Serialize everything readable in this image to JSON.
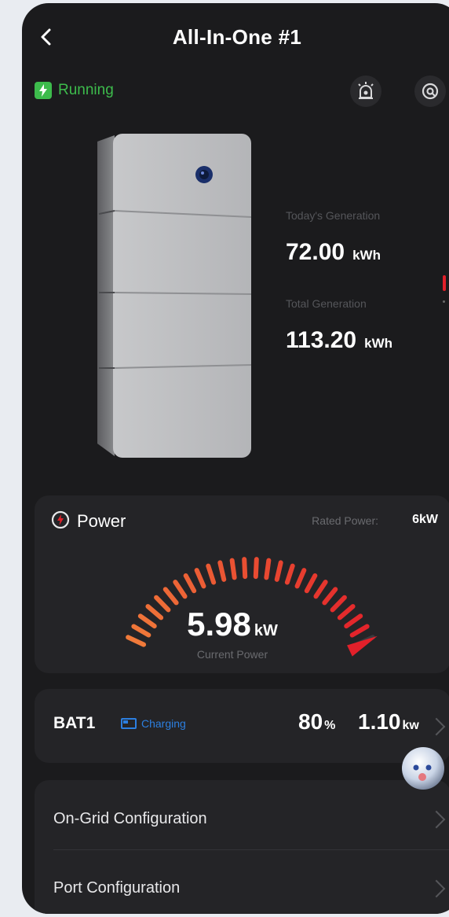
{
  "header": {
    "title": "All-In-One #1",
    "back_icon": "chevron-left-icon"
  },
  "status": {
    "label": "Running",
    "color": "#3dbb4c",
    "icon": "lightning-icon"
  },
  "toolbar": {
    "alarm_icon": "alarm-icon",
    "settings_icon": "settings-icon"
  },
  "generation": {
    "today_label": "Today's Generation",
    "today_value": "72.00",
    "today_unit": "kWh",
    "total_label": "Total Generation",
    "total_value": "113.20",
    "total_unit": "kWh"
  },
  "power": {
    "title": "Power",
    "rated_label": "Rated Power:",
    "rated_value": "6kW",
    "current_value": "5.98",
    "current_unit": "kW",
    "current_caption": "Current Power",
    "gauge_fraction": 0.9967
  },
  "battery": {
    "name": "BAT1",
    "status": "Charging",
    "percent": "80",
    "percent_unit": "%",
    "power": "1.10",
    "power_unit": "kw"
  },
  "config": {
    "items": [
      {
        "label": "On-Grid Configuration"
      },
      {
        "label": "Port Configuration"
      }
    ]
  },
  "colors": {
    "accent_red": "#e2202a",
    "accent_orange": "#f07a3a",
    "battery_blue": "#2c7fe0",
    "background": "#1b1b1d"
  }
}
